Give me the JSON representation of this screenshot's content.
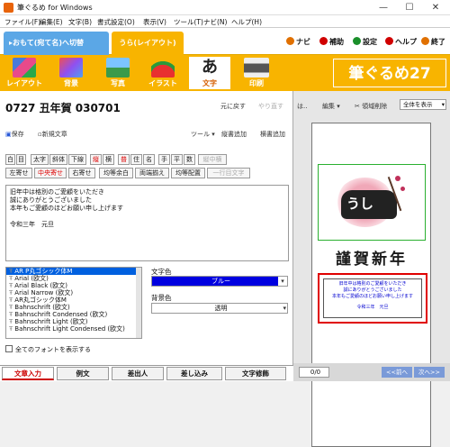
{
  "window": {
    "title": "筆ぐるめ for Windows",
    "minimize": "—",
    "maximize": "☐",
    "close": "✕"
  },
  "menu": [
    "ファイル(F)",
    "編集(E)",
    "文字(B)",
    "書式設定(O)",
    "表示(V)",
    "ツール(T)",
    "ナビ(N)",
    "ヘルプ(H)"
  ],
  "modes": {
    "omote": "▸おもて(宛て名)へ切替",
    "ura": "うら(レイアウト)"
  },
  "help_links": [
    {
      "label": "ナビ",
      "color": "#e07000"
    },
    {
      "label": "補助",
      "color": "#d00000"
    },
    {
      "label": "設定",
      "color": "#1a8f2a"
    },
    {
      "label": "ヘルプ",
      "color": "#d00000"
    },
    {
      "label": "終了",
      "color": "#e07000"
    }
  ],
  "toolbar": {
    "items": [
      "レイアウト",
      "背景",
      "写真",
      "イラスト",
      "文字",
      "印刷"
    ],
    "brand": "筆ぐるめ27"
  },
  "left": {
    "doc_title": "0727 丑年賀 030701",
    "undo": "元に戻す",
    "redo": "やり直す",
    "save": "保存",
    "new_text": "新規文章",
    "tool": "ツール",
    "vertical_add": "縦書追加",
    "horizontal_add": "横書追加",
    "fmt_row1": [
      "白",
      "目",
      "太字",
      "斜体",
      "下線",
      "縦",
      "横",
      "普",
      "住",
      "名",
      "手",
      "平",
      "数",
      "縦中横"
    ],
    "fmt_row2": [
      "左寄せ",
      "中央寄せ",
      "右寄せ",
      "均等余白",
      "両端揃え",
      "均等配置",
      "一行目文字"
    ],
    "text": "旧年中は格別のご愛顧をいただき\n誠にありがとうございました\n本年もご愛顧のほどお願い申し上げます\n\n令和三年　元旦",
    "fonts": [
      "AR P丸ゴシック体M",
      "Arial (欧文)",
      "Arial Black (欧文)",
      "Arial Narrow (欧文)",
      "AR丸ゴシック体M",
      "Bahnschrift (欧文)",
      "Bahnschrift Condensed (欧文)",
      "Bahnschrift Light (欧文)",
      "Bahnschrift Light Condensed (欧文)"
    ],
    "text_color_label": "文字色",
    "text_color_value": "ブルー",
    "bg_color_label": "背景色",
    "bg_color_value": "透明",
    "show_all_fonts": "全てのフォントを表示する",
    "tabs": [
      "文章入力",
      "例文",
      "差出人",
      "差し込み",
      "文字修飾"
    ]
  },
  "right": {
    "zoom_btn": "は..",
    "edit": "編集",
    "area_delete": "領域削除",
    "view_select": "全体を表示",
    "card_greeting": "謹賀新年",
    "card_cow_text": "うし",
    "card_message": [
      "旧年中は格別のご愛顧をいただき",
      "誠にありがとうございました",
      "本年もご愛顧のほどお願い申し上げます"
    ],
    "card_date": "令和三年　元旦",
    "page": "0/0",
    "prev": "<<前へ",
    "next": "次へ>>"
  }
}
